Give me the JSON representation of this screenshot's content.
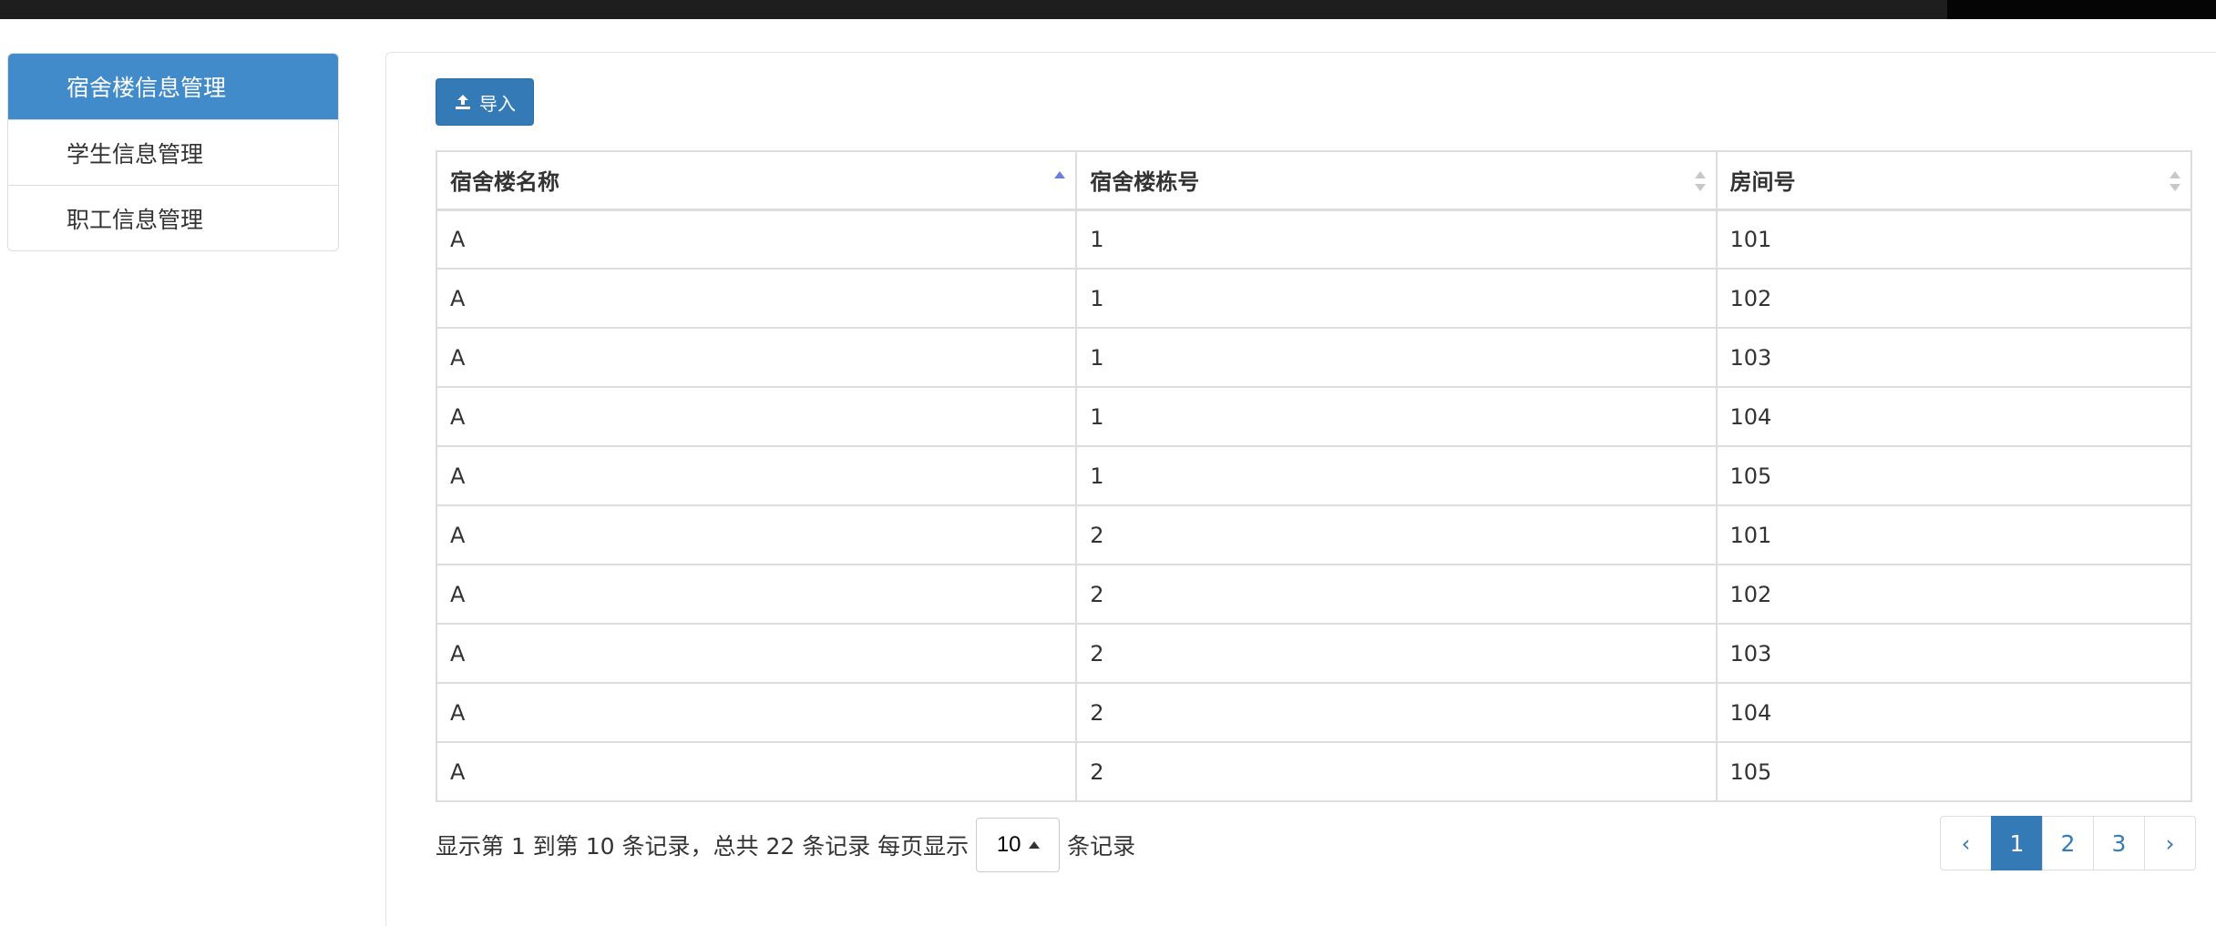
{
  "sidebar": {
    "items": [
      {
        "label": "宿舍楼信息管理",
        "active": true
      },
      {
        "label": "学生信息管理",
        "active": false
      },
      {
        "label": "职工信息管理",
        "active": false
      }
    ]
  },
  "toolbar": {
    "import_label": "导入",
    "import_icon": "upload-icon"
  },
  "table": {
    "columns": [
      "宿舍楼名称",
      "宿舍楼栋号",
      "房间号"
    ],
    "sort": {
      "column": 0,
      "direction": "asc"
    },
    "rows": [
      [
        "A",
        "1",
        "101"
      ],
      [
        "A",
        "1",
        "102"
      ],
      [
        "A",
        "1",
        "103"
      ],
      [
        "A",
        "1",
        "104"
      ],
      [
        "A",
        "1",
        "105"
      ],
      [
        "A",
        "2",
        "101"
      ],
      [
        "A",
        "2",
        "102"
      ],
      [
        "A",
        "2",
        "103"
      ],
      [
        "A",
        "2",
        "104"
      ],
      [
        "A",
        "2",
        "105"
      ]
    ]
  },
  "pager": {
    "info_prefix": "显示第 1 到第 10 条记录，总共 22 条记录 每页显示",
    "page_size": "10",
    "info_suffix": "条记录",
    "prev": "‹",
    "pages": [
      "1",
      "2",
      "3"
    ],
    "current_page": "1",
    "next": "›"
  },
  "colors": {
    "primary": "#337ab7",
    "sidebar_active": "#428bca",
    "border": "#dddddd",
    "topbar": "#1e1e1e"
  }
}
